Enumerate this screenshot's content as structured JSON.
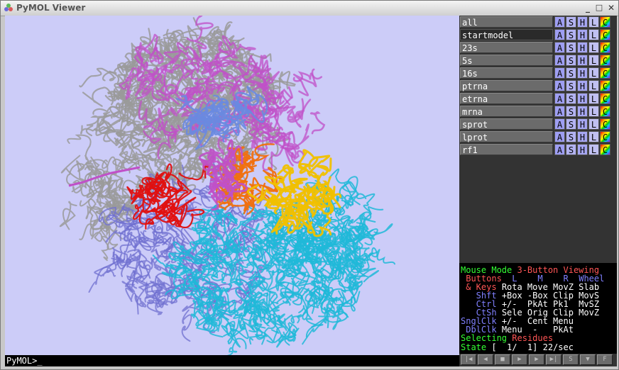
{
  "window": {
    "title": "PyMOL Viewer",
    "minimize_glyph": "_",
    "maximize_glyph": "□",
    "close_glyph": "✕"
  },
  "command_line": {
    "prompt": "PyMOL>_"
  },
  "object_buttons": {
    "a": "A",
    "s": "S",
    "h": "H",
    "l": "L",
    "c": "C"
  },
  "objects": [
    {
      "name": "all",
      "active": false
    },
    {
      "name": "startmodel",
      "active": true
    },
    {
      "name": "23s",
      "active": false
    },
    {
      "name": "5s",
      "active": false
    },
    {
      "name": "16s",
      "active": false
    },
    {
      "name": "ptrna",
      "active": false
    },
    {
      "name": "etrna",
      "active": false
    },
    {
      "name": "mrna",
      "active": false
    },
    {
      "name": "sprot",
      "active": false
    },
    {
      "name": "lprot",
      "active": false
    },
    {
      "name": "rf1",
      "active": false
    }
  ],
  "mouse_panel": {
    "mode_label": "Mouse Mode",
    "mode_value": "3-Button Viewing",
    "buttons_label": " Buttons",
    "col_l": "L",
    "col_m": "M",
    "col_r": "R",
    "col_wheel": "Wheel",
    "keys_label": " & Keys",
    "keys_vals": "Rota Move MovZ Slab",
    "shft_label": "   Shft",
    "shft_vals": "+Box -Box Clip MovS",
    "ctrl_label": "   Ctrl",
    "ctrl_vals": "+/-  PkAt Pk1  MvSZ",
    "ctsh_label": "   CtSh",
    "ctsh_vals": "Sele Orig Clip MovZ",
    "sngl_label": "SnglClk",
    "sngl_vals": "+/-  Cent Menu",
    "dbl_label": " DblClk",
    "dbl_vals": "Menu  -   PkAt",
    "selecting_label": "Selecting",
    "selecting_value": "Residues",
    "state_label": "State",
    "state_value": "[  1/  1] 22/sec"
  },
  "vcr_buttons": [
    {
      "icon": "rewind-icon",
      "glyph": "|◀"
    },
    {
      "icon": "step-back-icon",
      "glyph": "◀"
    },
    {
      "icon": "stop-icon",
      "glyph": "■"
    },
    {
      "icon": "play-icon",
      "glyph": "▶"
    },
    {
      "icon": "step-forward-icon",
      "glyph": "▶"
    },
    {
      "icon": "forward-end-icon",
      "glyph": "▶|"
    },
    {
      "icon": "scene-icon",
      "glyph": "S"
    },
    {
      "icon": "dropdown-icon",
      "glyph": "▼"
    },
    {
      "icon": "fullscreen-icon",
      "glyph": "F"
    }
  ],
  "colors": {
    "viewer_bg": "#ccccf8",
    "rrna_gray": "#9a9a9a",
    "magenta": "#c050c8",
    "cyan": "#20b8d8",
    "red": "#e01010",
    "yellow": "#f0c000",
    "orange": "#f07010",
    "blue": "#6a8ae0",
    "slate": "#7070d0"
  }
}
